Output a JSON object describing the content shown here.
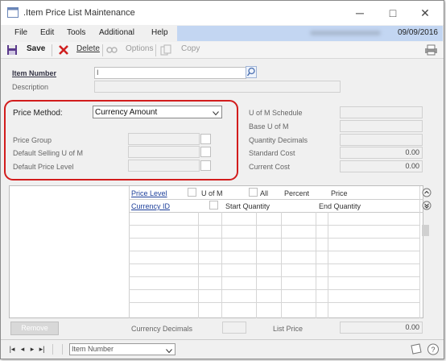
{
  "window": {
    "title": ".Item Price List Maintenance",
    "minimize": "─",
    "maximize": "□",
    "close": "✕"
  },
  "menu": {
    "items": [
      "File",
      "Edit",
      "Tools",
      "Additional",
      "Help"
    ],
    "date": "09/09/2016"
  },
  "toolbar": {
    "save": "Save",
    "delete": "Delete",
    "options": "Options",
    "copy": "Copy"
  },
  "header": {
    "item_number_label": "Item Number",
    "item_number_value": "I",
    "description_label": "Description"
  },
  "price": {
    "price_method_label": "Price Method:",
    "price_method_value": "Currency Amount",
    "price_group_label": "Price Group",
    "default_selling_label": "Default Selling U of M",
    "default_price_level_label": "Default Price Level"
  },
  "right_panel": {
    "uom_schedule_label": "U of M Schedule",
    "base_uom_label": "Base U of M",
    "quantity_decimals_label": "Quantity Decimals",
    "standard_cost_label": "Standard Cost",
    "standard_cost_value": "0.00",
    "current_cost_label": "Current Cost",
    "current_cost_value": "0.00"
  },
  "grid": {
    "price_level": "Price Level",
    "u_of_m": "U of M",
    "all": "All",
    "percent": "Percent",
    "price": "Price",
    "currency_id": "Currency ID",
    "start_quantity": "Start Quantity",
    "end_quantity": "End Quantity"
  },
  "footer": {
    "remove": "Remove",
    "currency_decimals_label": "Currency Decimals",
    "list_price_label": "List Price",
    "list_price_value": "0.00",
    "sort_value": "Item Number"
  }
}
